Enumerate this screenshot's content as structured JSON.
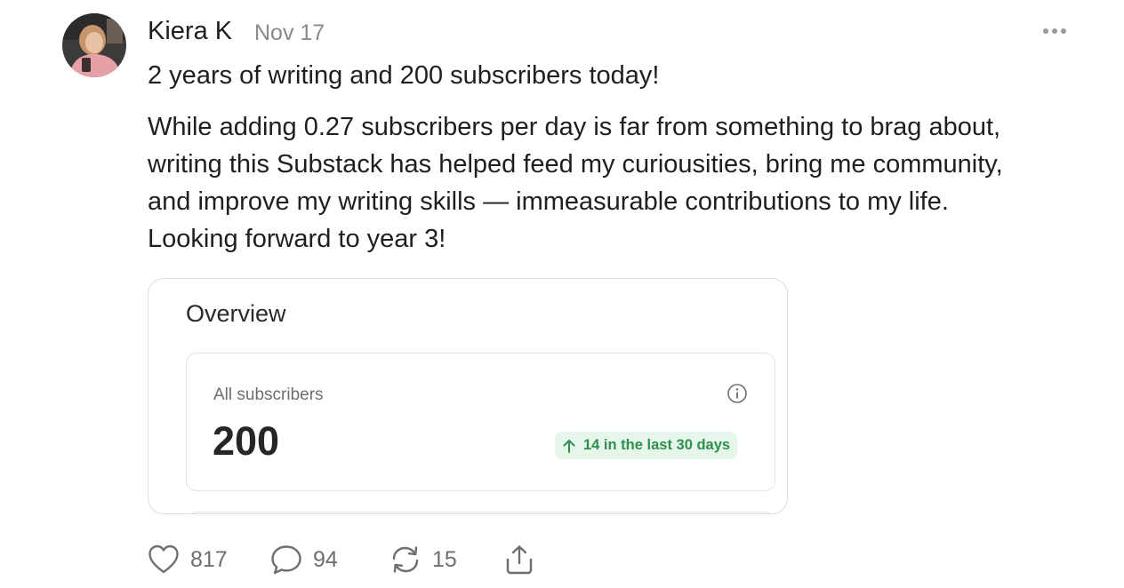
{
  "post": {
    "author": "Kiera K",
    "date": "Nov 17",
    "headline": "2 years of writing and 200 subscribers today!",
    "body_lines": [
      "While adding 0.27 subscribers per day is far from something to brag about,",
      "writing this Substack has helped feed my curiousities, bring me community,",
      "and improve my writing skills — immeasurable contributions to my life.",
      "Looking forward to year 3!"
    ]
  },
  "card": {
    "title": "Overview",
    "metric_label": "All subscribers",
    "metric_value": "200",
    "badge_text": "14 in the last 30 days"
  },
  "actions": {
    "likes": "817",
    "comments": "94",
    "restacks": "15"
  },
  "icons": {
    "more": "more-options-icon",
    "info": "info-icon",
    "badge_arrow": "arrow-up-icon",
    "like": "heart-icon",
    "comment": "comment-icon",
    "restack": "restack-icon",
    "share": "share-icon"
  },
  "colors": {
    "badge_bg": "#e6f6ea",
    "badge_text": "#2f8f4e",
    "muted": "#8a8a8a"
  }
}
